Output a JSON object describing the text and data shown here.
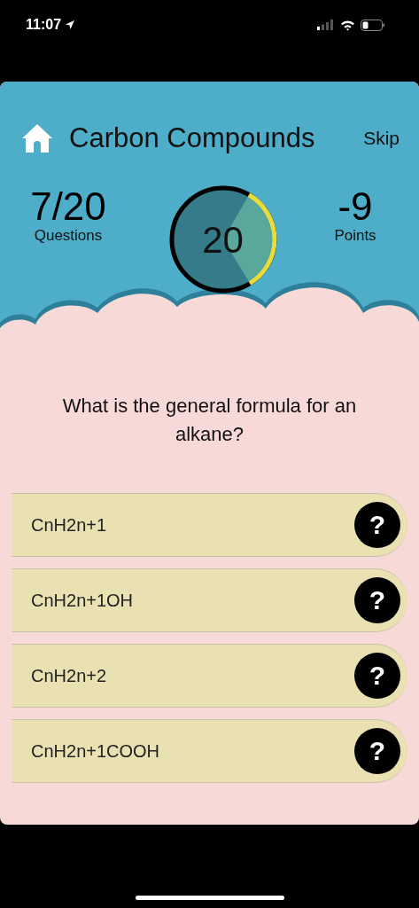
{
  "status_bar": {
    "time": "11:07"
  },
  "header": {
    "title": "Carbon Compounds",
    "skip": "Skip"
  },
  "stats": {
    "questions": {
      "value": "7/20",
      "label": "Questions"
    },
    "timer": {
      "value": "20"
    },
    "points": {
      "value": "-9",
      "label": "Points"
    }
  },
  "question": "What is the general formula for an alkane?",
  "answers": [
    {
      "text": "CnH2n+1",
      "hint": "?"
    },
    {
      "text": "CnH2n+1OH",
      "hint": "?"
    },
    {
      "text": "CnH2n+2",
      "hint": "?"
    },
    {
      "text": "CnH2n+1COOH",
      "hint": "?"
    }
  ]
}
